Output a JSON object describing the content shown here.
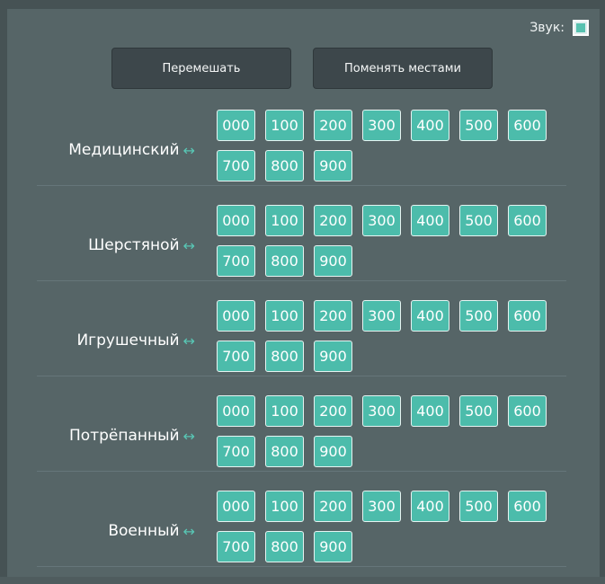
{
  "sound": {
    "label": "Звук:",
    "checked": false
  },
  "actions": {
    "shuffle_label": "Перемешать",
    "swap_label": "Поменять местами"
  },
  "swap_icon_glyph": "↔",
  "chip_labels": [
    "000",
    "100",
    "200",
    "300",
    "400",
    "500",
    "600",
    "700",
    "800",
    "900"
  ],
  "groups": [
    {
      "name": "Медицинский"
    },
    {
      "name": "Шерстяной"
    },
    {
      "name": "Игрушечный"
    },
    {
      "name": "Потрёпанный"
    },
    {
      "name": "Военный"
    }
  ],
  "colors": {
    "accent": "#4cbcab",
    "background": "#566567",
    "button": "#3d474b"
  }
}
